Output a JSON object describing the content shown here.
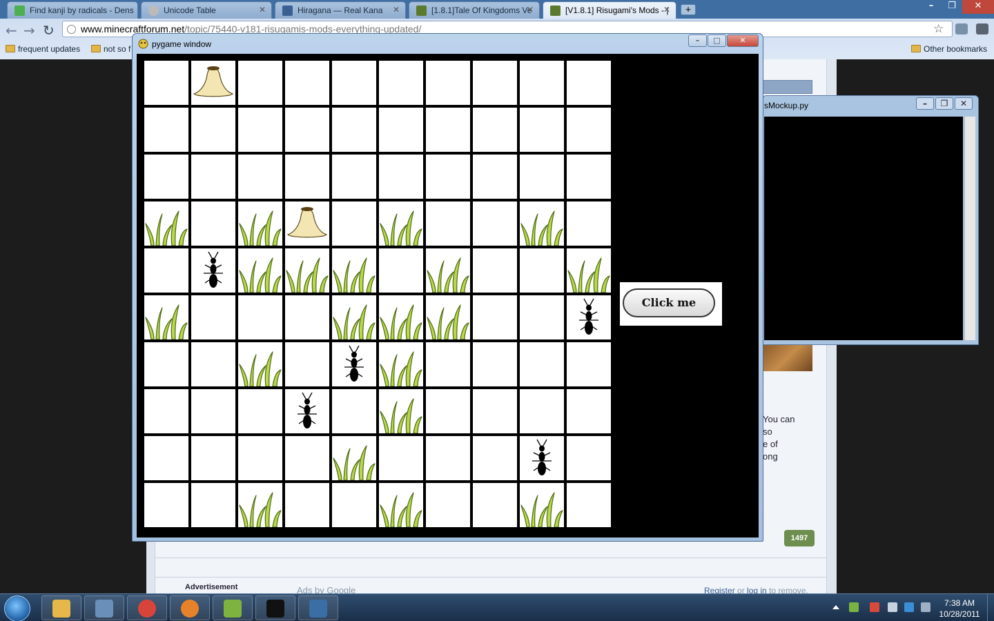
{
  "browser": {
    "tabs": [
      {
        "title": "Find kanji by radicals - Dens",
        "icon": "kanji-icon",
        "color": "#4caf50",
        "active": false
      },
      {
        "title": "Unicode Table",
        "icon": "unicode-icon",
        "color": "#999999",
        "active": false
      },
      {
        "title": "Hiragana — Real Kana",
        "icon": "kana-icon",
        "color": "#3a5f93",
        "active": false
      },
      {
        "title": "[1.8.1]Tale Of Kingdoms Ve",
        "icon": "minecraft-icon",
        "color": "#5b7a2e",
        "active": false
      },
      {
        "title": "[V1.8.1] Risugami's Mods - |",
        "icon": "minecraft-icon",
        "color": "#5b7a2e",
        "active": true
      }
    ],
    "url_host": "www.minecraftforum.net",
    "url_path": "/topic/75440-v181-risugamis-mods-everything-updated/",
    "bookmarks": [
      "frequent updates",
      "not so f"
    ],
    "other_bookmarks": "Other bookmarks"
  },
  "page_behind": {
    "side_text": [
      "You can",
      "so",
      "e of",
      "ong"
    ],
    "post_count": "1497",
    "advertisement": "Advertisement",
    "ads_by_google": "Ads by Google",
    "register": "Register",
    "or": "or",
    "login": "log in",
    "to_remove": "to remove."
  },
  "mockup_window": {
    "title": "sMockup.py"
  },
  "pygame_window": {
    "title": "pygame window",
    "button_label": "Click me",
    "grid": {
      "rows": 10,
      "cols": 10,
      "cells": [
        ".H........",
        "..........",
        "..........",
        "G.GH.G..G.",
        ".AGGG.G..G",
        "G...GGG..A",
        "..G.AG....",
        "...A.G....",
        "....G...A.",
        "..G..G..G."
      ],
      "legend": {
        "G": "grass",
        "A": "ant",
        "H": "anthill",
        ".": "empty"
      }
    }
  },
  "taskbar": {
    "apps": [
      {
        "name": "explorer-icon",
        "color": "#e6b84a"
      },
      {
        "name": "computer-icon",
        "color": "#6a8fb8"
      },
      {
        "name": "chrome-icon",
        "color": "#d9443a"
      },
      {
        "name": "firefox-icon",
        "color": "#e8822a"
      },
      {
        "name": "notepadpp-icon",
        "color": "#7fb33f"
      },
      {
        "name": "cmd-icon",
        "color": "#111111"
      },
      {
        "name": "python-icon",
        "color": "#3a6ea5"
      }
    ],
    "time": "7:38 AM",
    "date": "10/28/2011"
  }
}
